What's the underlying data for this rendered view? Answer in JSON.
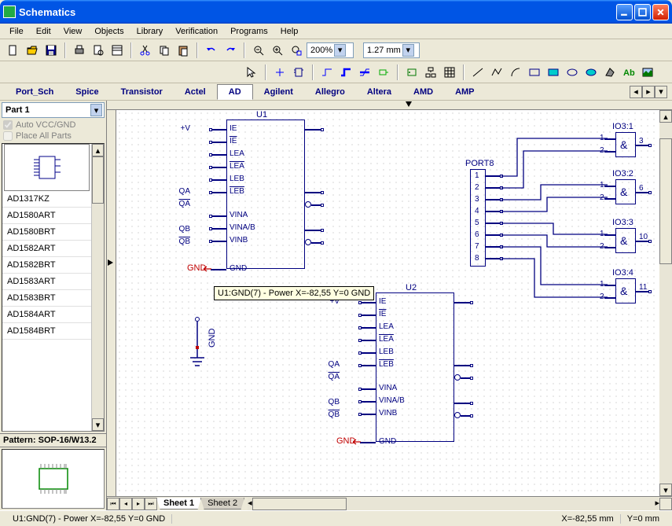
{
  "window": {
    "title": "Schematics"
  },
  "menu": [
    "File",
    "Edit",
    "View",
    "Objects",
    "Library",
    "Verification",
    "Programs",
    "Help"
  ],
  "toolbar1": {
    "zoom_value": "200%",
    "grid_value": "1.27 mm"
  },
  "libraries": [
    "Port_Sch",
    "Spice",
    "Transistor",
    "Actel",
    "AD",
    "Agilent",
    "Allegro",
    "Altera",
    "AMD",
    "AMP"
  ],
  "libraries_selected": "AD",
  "leftpanel": {
    "part_combo": "Part 1",
    "auto_vcc": "Auto VCC/GND",
    "place_all": "Place All Parts",
    "parts": [
      "AD1317KZ",
      "AD1580ART",
      "AD1580BRT",
      "AD1582ART",
      "AD1582BRT",
      "AD1583ART",
      "AD1583BRT",
      "AD1584ART",
      "AD1584BRT"
    ],
    "pattern_label": "Pattern: SOP-16/W13.2"
  },
  "sheets": [
    "Sheet 1",
    "Sheet 2"
  ],
  "status": {
    "left": "U1:GND(7) - Power   X=-82,55  Y=0   GND",
    "x": "X=-82,55 mm",
    "y": "Y=0 mm"
  },
  "tooltip": "U1:GND(7) - Power   X=-82,55  Y=0   GND",
  "components": {
    "u1": {
      "ref": "U1",
      "pins_left": [
        "IE",
        "IE",
        "LEA",
        "LEA",
        "LEB",
        "LEB",
        "",
        "VINA",
        "VINA/B",
        "VINB"
      ],
      "pins_left_bar": [
        false,
        true,
        false,
        true,
        false,
        true,
        false,
        false,
        false,
        false
      ],
      "pins_right": [
        "+V",
        "",
        "",
        "",
        "",
        "QA",
        "QA",
        "",
        "QB",
        "QB"
      ],
      "pins_right_bar": [
        false,
        false,
        false,
        false,
        false,
        false,
        true,
        false,
        false,
        true
      ],
      "gnd_label": "GND",
      "gnd_net": "GND"
    },
    "u2": {
      "ref": "U2",
      "pins_left": [
        "IE",
        "IE",
        "LEA",
        "LEA",
        "LEB",
        "LEB",
        "",
        "VINA",
        "VINA/B",
        "VINB"
      ],
      "pins_left_bar": [
        false,
        true,
        false,
        true,
        false,
        true,
        false,
        false,
        false,
        false
      ],
      "pins_right": [
        "+V",
        "",
        "",
        "",
        "",
        "QA",
        "QA",
        "",
        "QB",
        "QB"
      ],
      "pins_right_bar": [
        false,
        false,
        false,
        false,
        false,
        false,
        true,
        false,
        false,
        true
      ],
      "gnd_label": "GND",
      "gnd_net": "GND"
    },
    "port8": {
      "ref": "PORT8",
      "pins": [
        "1",
        "2",
        "3",
        "4",
        "5",
        "6",
        "7",
        "8"
      ]
    },
    "io3": [
      {
        "ref": "IO3:1",
        "out": "3"
      },
      {
        "ref": "IO3:2",
        "out": "6"
      },
      {
        "ref": "IO3:3",
        "out": "10"
      },
      {
        "ref": "IO3:4",
        "out": "11"
      }
    ],
    "gnd_sym": "GND"
  }
}
